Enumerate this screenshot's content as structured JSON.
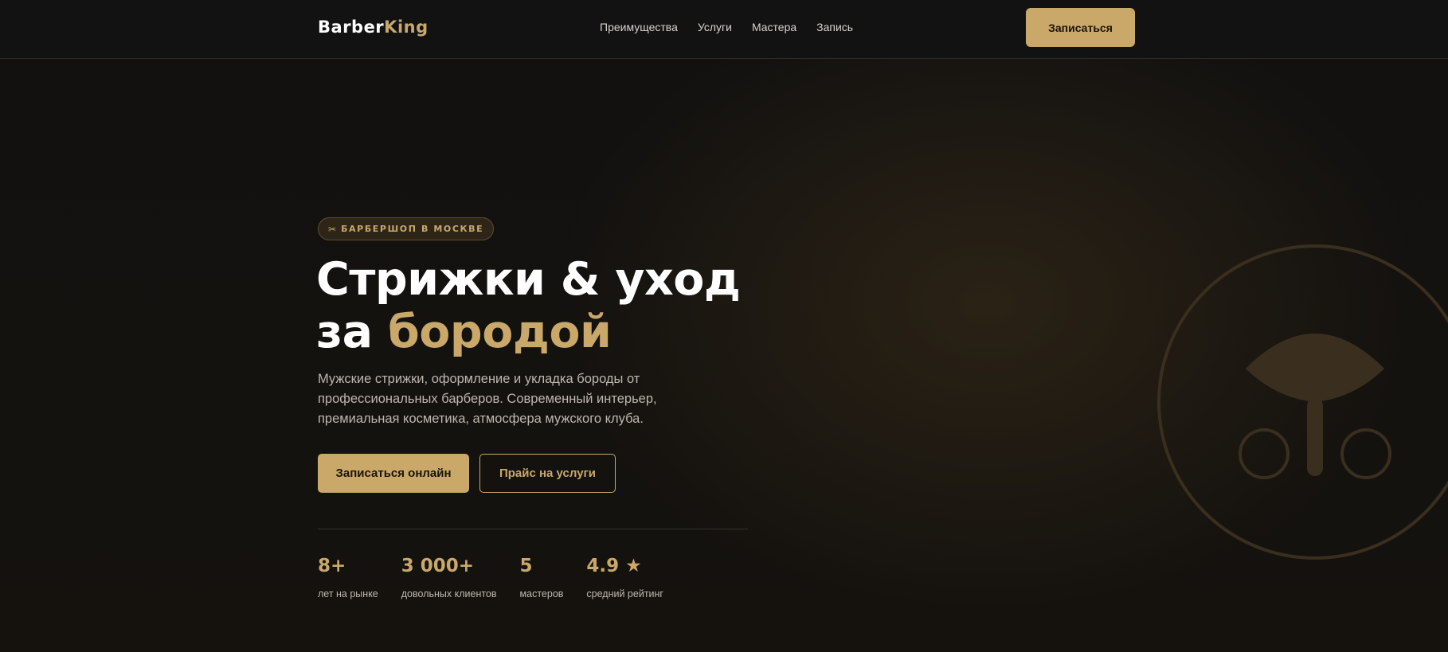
{
  "brand": {
    "name_part1": "Barber",
    "name_part2": "King"
  },
  "nav": {
    "items": [
      "Преимущества",
      "Услуги",
      "Мастера",
      "Запись"
    ]
  },
  "header": {
    "cta_label": "Записаться"
  },
  "hero": {
    "badge_icon": "✂",
    "badge_text": "БАРБЕРШОП В МОСКВЕ",
    "title_line1": "Стрижки & уход",
    "title_line2_plain": "за ",
    "title_line2_accent": "бородой",
    "description": "Мужские стрижки, оформление и укладка бороды от профессиональных барберов. Современный интерьер, премиальная косметика, атмосфера мужского клуба.",
    "primary_button": "Записаться онлайн",
    "secondary_button": "Прайс на услуги"
  },
  "stats": [
    {
      "value": "8+",
      "label": "лет на рынке"
    },
    {
      "value": "3 000+",
      "label": "довольных клиентов"
    },
    {
      "value": "5",
      "label": "мастеров"
    },
    {
      "value": "4.9 ★",
      "label": "средний рейтинг"
    }
  ],
  "colors": {
    "accent": "#c9a86a",
    "background": "#121110",
    "text_muted": "#bdb8ae"
  },
  "icons": {
    "badge": "scissors-icon",
    "decoration": "barber-emblem-icon"
  }
}
